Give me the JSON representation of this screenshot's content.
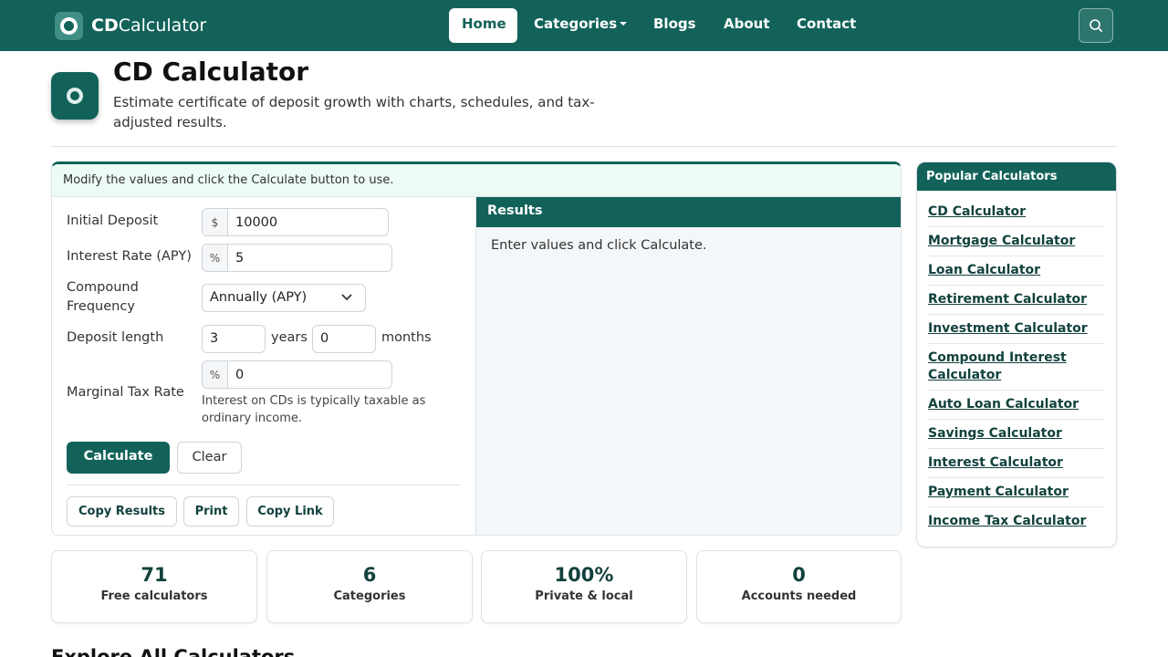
{
  "brand": {
    "bold": "CD",
    "rest": "Calculator"
  },
  "nav": {
    "items": [
      {
        "label": "Home",
        "active": true
      },
      {
        "label": "Categories",
        "dropdown": true
      },
      {
        "label": "Blogs"
      },
      {
        "label": "About"
      },
      {
        "label": "Contact"
      }
    ],
    "search_icon": "search-icon"
  },
  "header": {
    "title": "CD Calculator",
    "subtitle": "Estimate certificate of deposit growth with charts, schedules, and tax-adjusted results."
  },
  "calculator": {
    "notice": "Modify the values and click the Calculate button to use.",
    "initial_deposit": {
      "label": "Initial Deposit",
      "prefix": "$",
      "value": "10000"
    },
    "interest_rate": {
      "label": "Interest Rate (APY)",
      "prefix": "%",
      "value": "5"
    },
    "compound": {
      "label": "Compound Frequency",
      "value": "Annually (APY)"
    },
    "length": {
      "label": "Deposit length",
      "years": "3",
      "years_unit": "years",
      "months": "0",
      "months_unit": "months"
    },
    "tax": {
      "label": "Marginal Tax Rate",
      "prefix": "%",
      "value": "0",
      "help": "Interest on CDs is typically taxable as ordinary income."
    },
    "calculate_label": "Calculate",
    "clear_label": "Clear",
    "copy_results_label": "Copy Results",
    "print_label": "Print",
    "copy_link_label": "Copy Link"
  },
  "results": {
    "heading": "Results",
    "message": "Enter values and click Calculate."
  },
  "stats": [
    {
      "value": "71",
      "label": "Free calculators"
    },
    {
      "value": "6",
      "label": "Categories"
    },
    {
      "value": "100%",
      "label": "Private & local"
    },
    {
      "value": "0",
      "label": "Accounts needed"
    }
  ],
  "explore_heading": "Explore All Calculators",
  "sidebar": {
    "heading": "Popular Calculators",
    "items": [
      "CD Calculator",
      "Mortgage Calculator",
      "Loan Calculator",
      "Retirement Calculator",
      "Investment Calculator",
      "Compound Interest Calculator",
      "Auto Loan Calculator",
      "Savings Calculator",
      "Interest Calculator",
      "Payment Calculator",
      "Income Tax Calculator"
    ]
  },
  "colors": {
    "primary": "#12625a",
    "notice_bg": "#ecfbf4",
    "results_bg": "#f4f7f9"
  }
}
